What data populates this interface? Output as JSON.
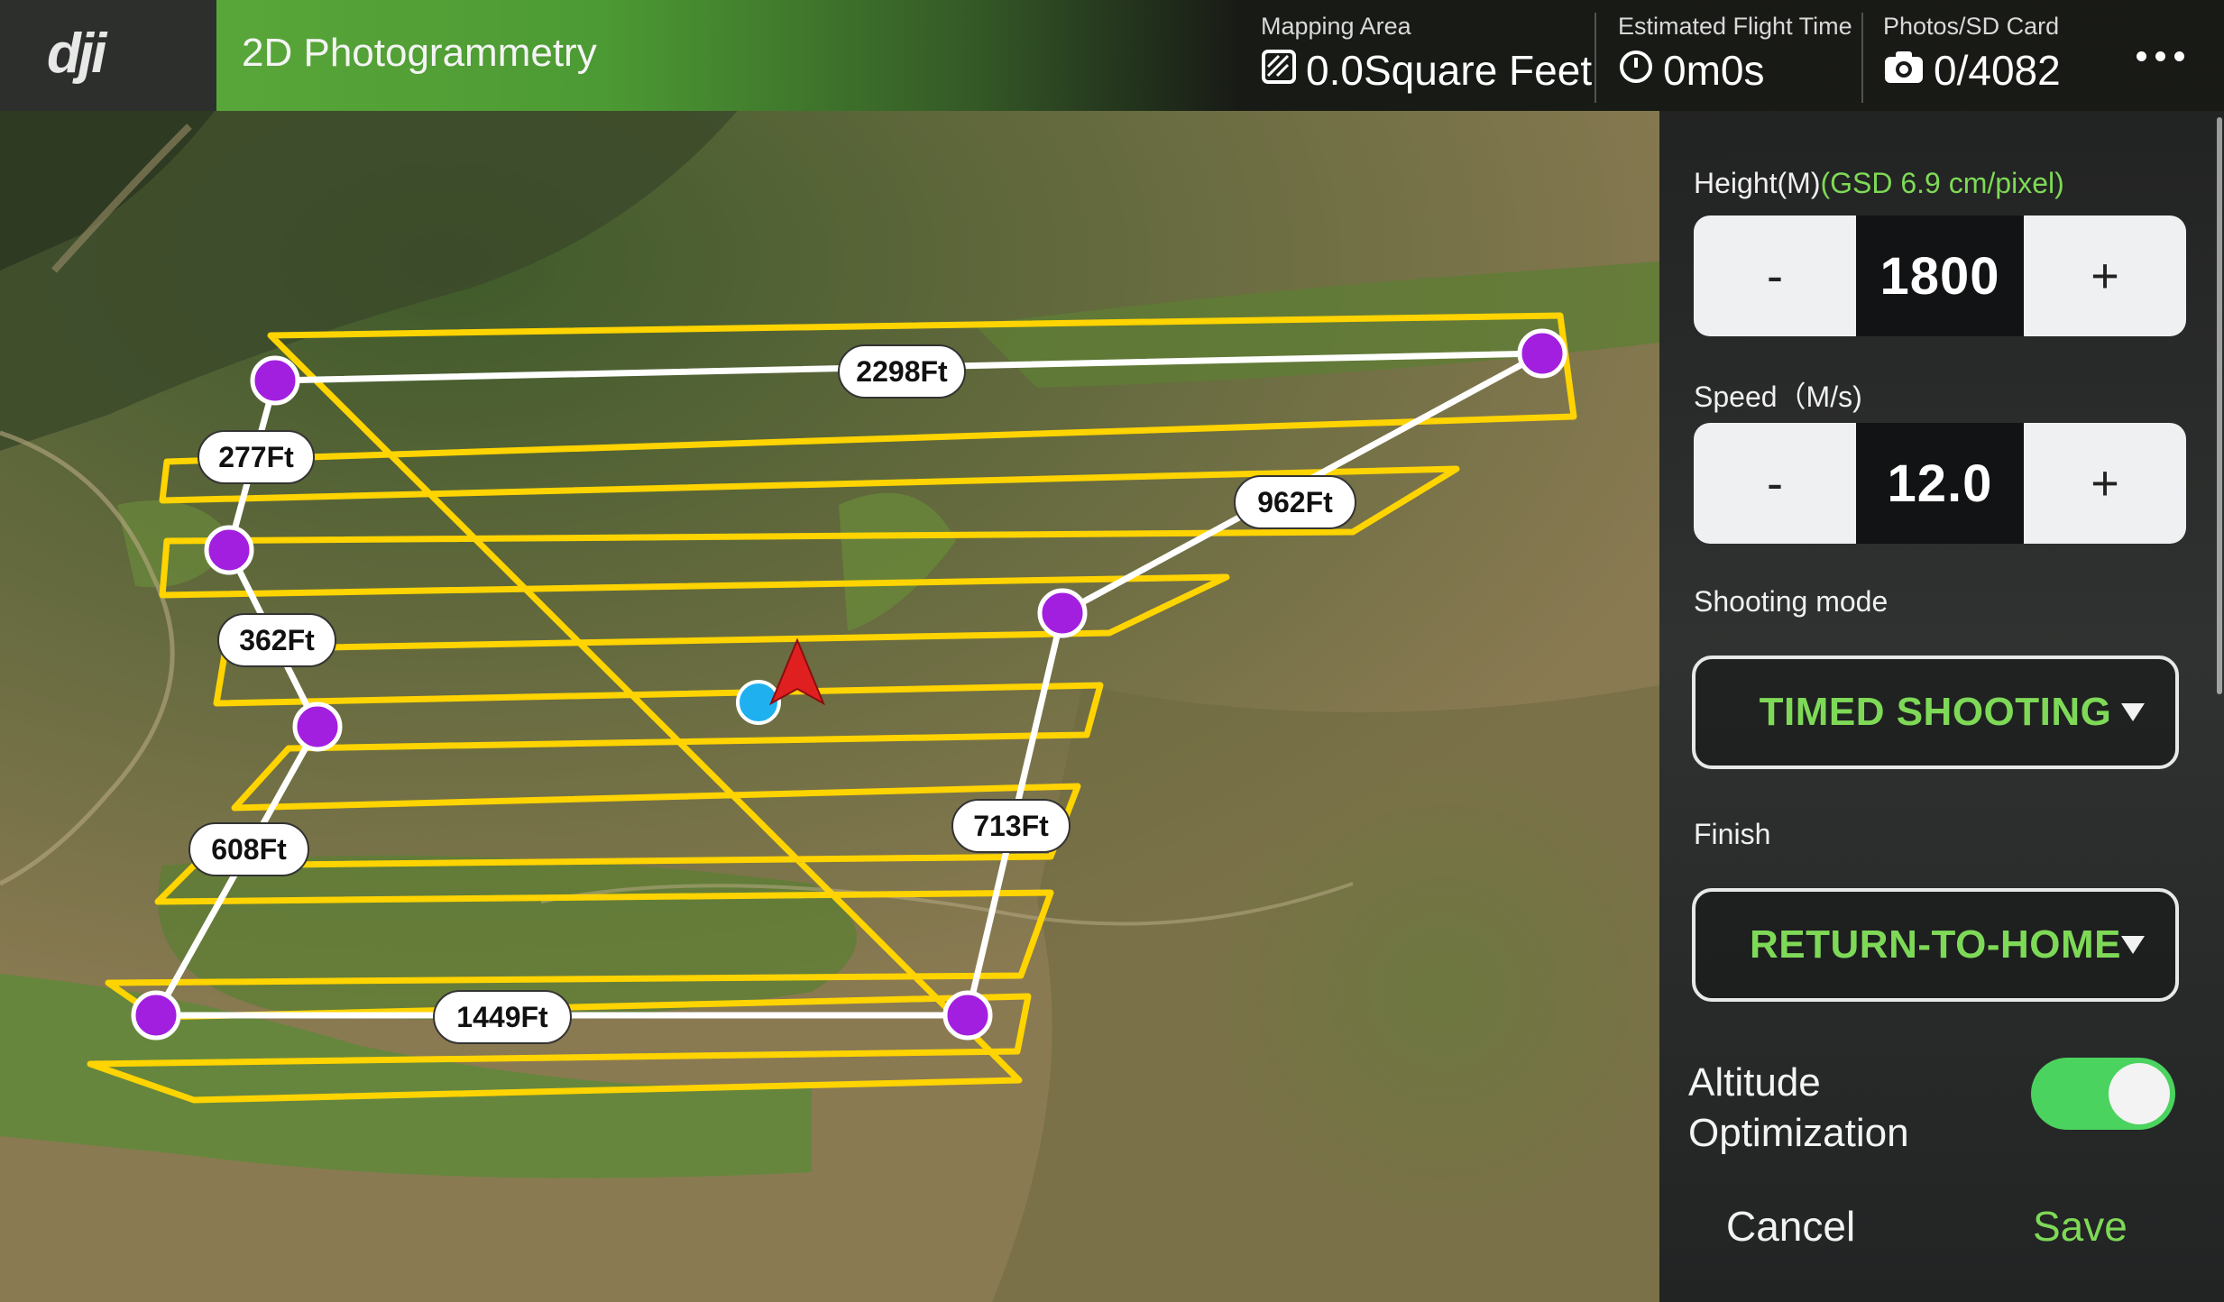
{
  "colors": {
    "accent_green": "#7ed957",
    "route_yellow": "#ffd400",
    "waypoint_purple": "#a31fe0",
    "aircraft_red": "#e02020",
    "home_blue": "#1fb0ef"
  },
  "header": {
    "logo": "dji",
    "mode_title": "2D Photogrammetry",
    "mapping_area": {
      "label": "Mapping Area",
      "value": "0.0Square Feet",
      "icon": "area-hatch-icon"
    },
    "flight_time": {
      "label": "Estimated Flight Time",
      "value": "0m0s",
      "icon": "clock-icon"
    },
    "photos": {
      "label": "Photos/SD Card",
      "value": "0/4082",
      "icon": "camera-icon"
    },
    "more_icon": "more-dots-icon"
  },
  "map": {
    "edge_labels": [
      "2298Ft",
      "962Ft",
      "713Ft",
      "1449Ft",
      "608Ft",
      "362Ft",
      "277Ft"
    ],
    "waypoint_count": 7
  },
  "panel": {
    "height": {
      "label": "Height(M)",
      "gsd": "(GSD   6.9 cm/pixel)",
      "minus": "-",
      "value": "1800",
      "plus": "+"
    },
    "speed": {
      "label": "Speed（M/s)",
      "minus": "-",
      "value": "12.0",
      "plus": "+"
    },
    "shooting_mode": {
      "label": "Shooting mode",
      "value": "TIMED SHOOTING"
    },
    "finish": {
      "label": "Finish",
      "value": "RETURN-TO-HOME"
    },
    "altitude_optimization": {
      "label": "Altitude Optimization",
      "enabled": true
    },
    "cancel_label": "Cancel",
    "save_label": "Save"
  }
}
